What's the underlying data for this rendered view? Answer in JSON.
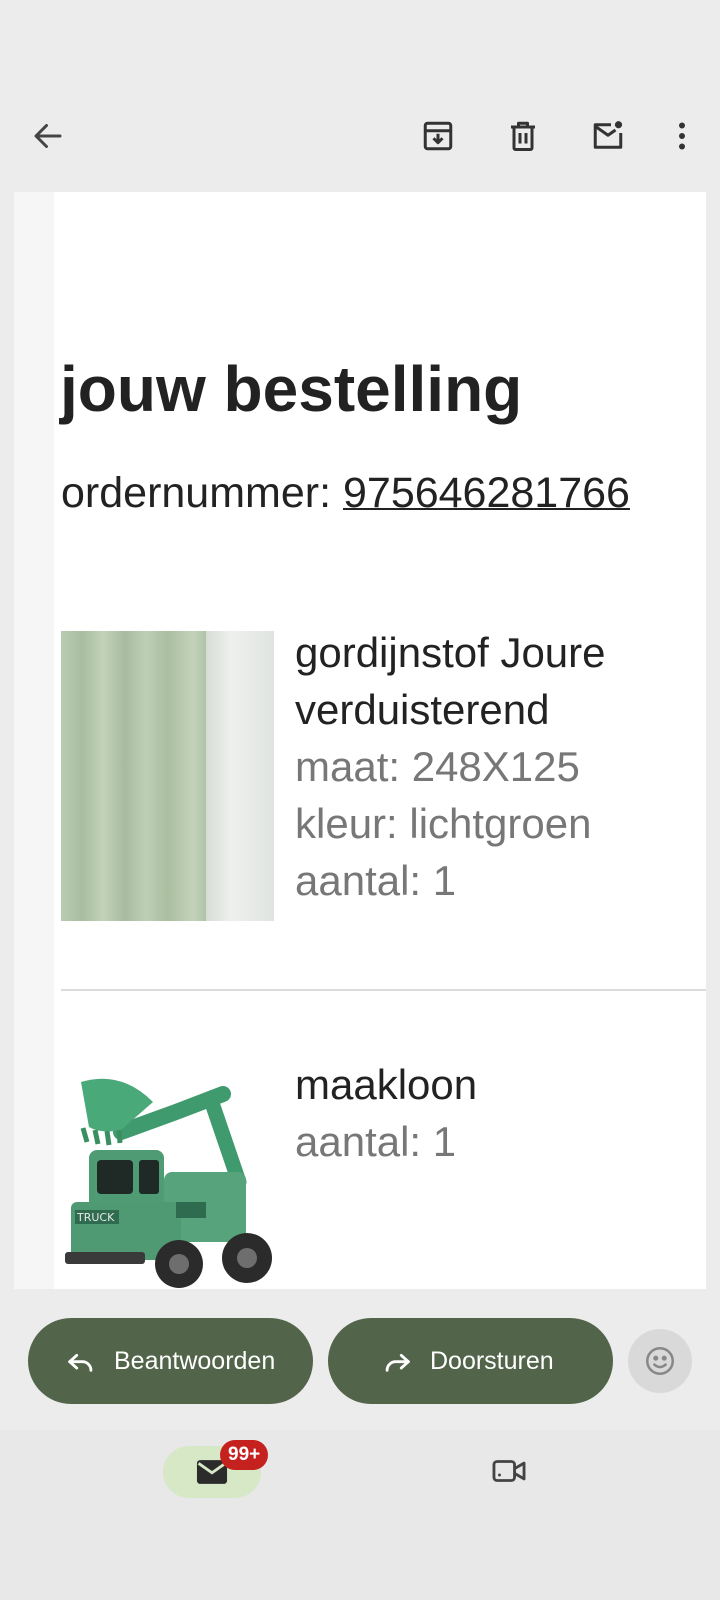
{
  "toolbar": {
    "back_icon": "arrow-left-icon",
    "archive_icon": "archive-icon",
    "delete_icon": "trash-icon",
    "mark_unread_icon": "mail-unread-icon",
    "more_icon": "more-vert-icon"
  },
  "email": {
    "headline": "jouw bestelling",
    "order_label": "ordernummer: ",
    "order_number": "975646281766",
    "items": [
      {
        "image": "green-curtain-image",
        "name_line1": "gordijnstof Joure",
        "name_line2": "verduisterend",
        "size": "maat: 248X125",
        "color": "kleur: lichtgroen",
        "quantity": "aantal: 1"
      },
      {
        "image": "green-toy-excavator-truck-image",
        "name_line1": "maakloon",
        "quantity": "aantal: 1"
      }
    ]
  },
  "actions": {
    "reply_label": "Beantwoorden",
    "forward_label": "Doorsturen",
    "emoji_icon": "emoji-smile-icon"
  },
  "bottom_nav": {
    "mail_badge": "99+",
    "mail_icon": "mail-icon",
    "meet_icon": "video-camera-icon"
  },
  "colors": {
    "accent_green": "#52644a",
    "badge_red": "#c5221f",
    "active_tab": "#d6e8c6"
  }
}
